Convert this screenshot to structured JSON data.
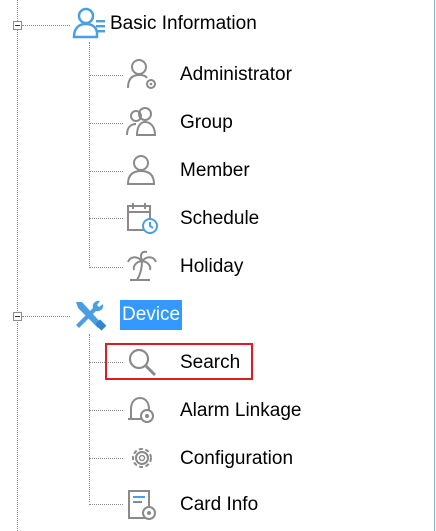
{
  "tree": {
    "groups": [
      {
        "label": "Basic Information",
        "icon": "users-list-icon",
        "expanded": true,
        "children": [
          {
            "label": "Administrator",
            "icon": "admin-user-gear-icon"
          },
          {
            "label": "Group",
            "icon": "group-users-icon"
          },
          {
            "label": "Member",
            "icon": "member-user-icon"
          },
          {
            "label": "Schedule",
            "icon": "calendar-clock-icon"
          },
          {
            "label": "Holiday",
            "icon": "palm-tree-icon"
          }
        ]
      },
      {
        "label": "Device",
        "icon": "wrench-screwdriver-icon",
        "expanded": true,
        "selected": true,
        "children": [
          {
            "label": "Search",
            "icon": "magnifier-icon",
            "highlighted": true
          },
          {
            "label": "Alarm Linkage",
            "icon": "alarm-bell-gear-icon"
          },
          {
            "label": "Configuration",
            "icon": "gears-icon"
          },
          {
            "label": "Card Info",
            "icon": "card-gear-icon"
          }
        ]
      }
    ]
  },
  "colors": {
    "selection": "#3399ff",
    "highlight_border": "#e11b22",
    "icon_blue": "#4a9fe3",
    "icon_gray": "#8a8a8a"
  }
}
